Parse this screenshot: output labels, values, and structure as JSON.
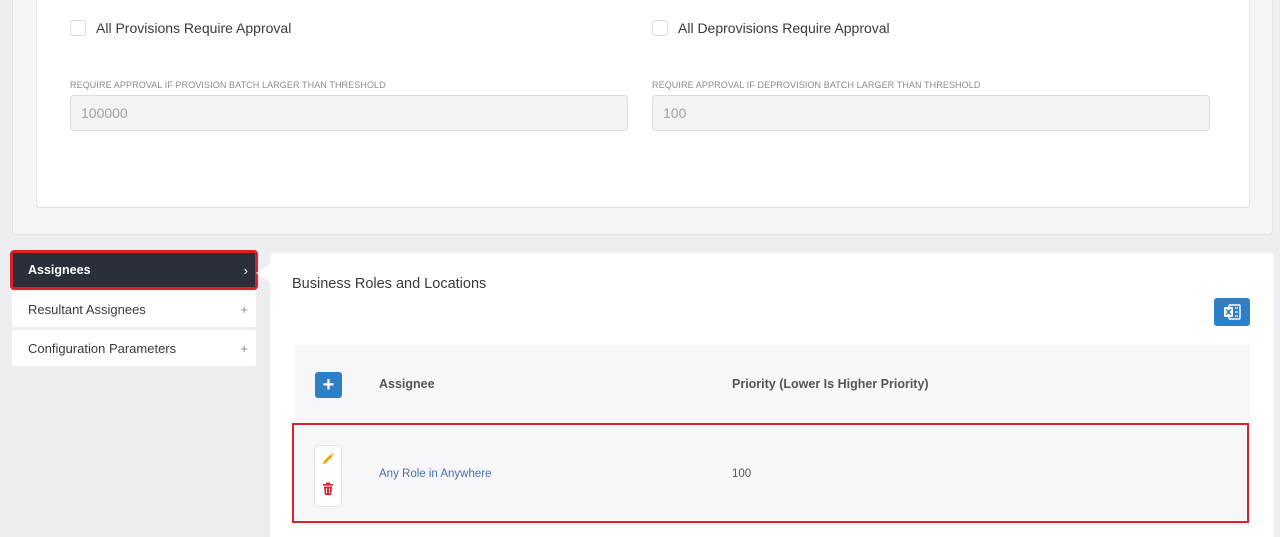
{
  "approvals": {
    "provisions_checkbox_label": "All Provisions Require Approval",
    "deprovisions_checkbox_label": "All Deprovisions Require Approval",
    "provisions_checked": false,
    "deprovisions_checked": false,
    "provision_threshold": {
      "label": "REQUIRE APPROVAL IF PROVISION BATCH LARGER THAN THRESHOLD",
      "value": "100000"
    },
    "deprovision_threshold": {
      "label": "REQUIRE APPROVAL IF DEPROVISION BATCH LARGER THAN THRESHOLD",
      "value": "100"
    }
  },
  "nav": {
    "items": [
      {
        "label": "Assignees",
        "sign": "›",
        "active": true
      },
      {
        "label": "Resultant Assignees",
        "sign": "+",
        "active": false
      },
      {
        "label": "Configuration Parameters",
        "sign": "+",
        "active": false
      }
    ]
  },
  "main": {
    "section_title": "Business Roles and Locations",
    "export_icon": "excel-icon",
    "add_label": "+",
    "columns": [
      "Assignee",
      "Priority (Lower Is Higher Priority)"
    ],
    "rows": [
      {
        "assignee": "Any Role in Anywhere",
        "priority": "100"
      }
    ]
  },
  "colors": {
    "accent_blue": "#2f7fc6",
    "nav_active_bg": "#2b2f3a",
    "highlight_red": "#d8202e",
    "edit_icon": "#f0a500",
    "delete_icon": "#d8202e"
  }
}
